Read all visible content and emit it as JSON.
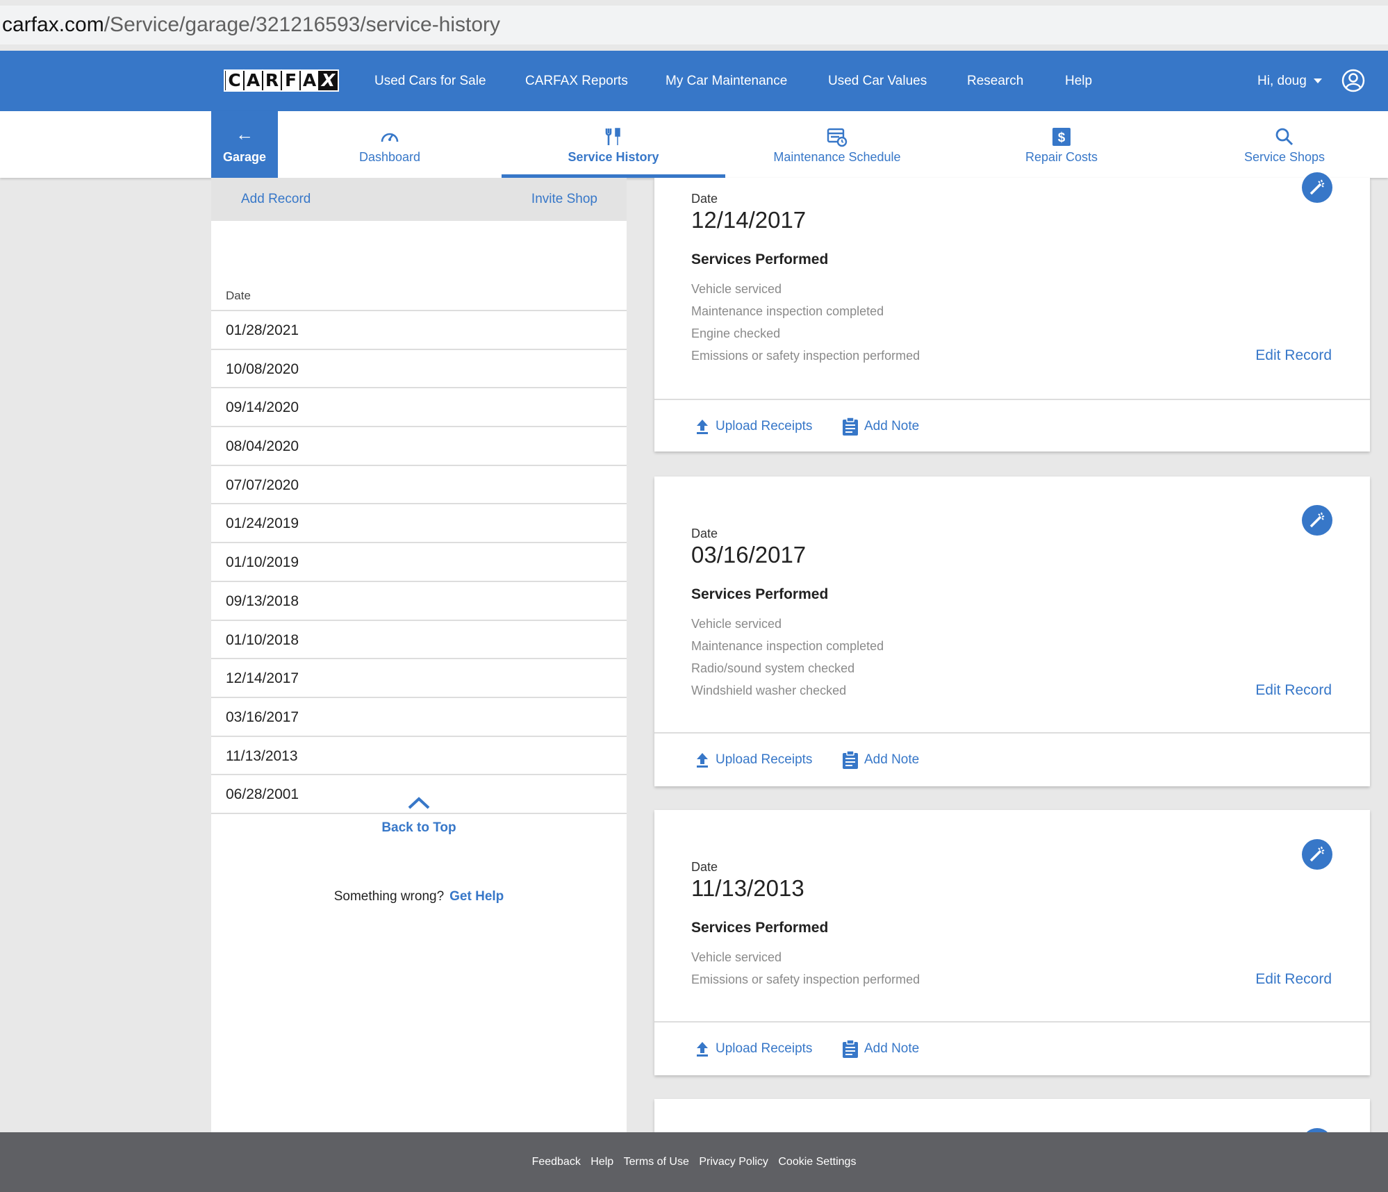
{
  "url": {
    "host": "carfax.com",
    "path": "/Service/garage/321216593/service-history"
  },
  "topnav": {
    "logo": [
      "C",
      "A",
      "R",
      "F",
      "A",
      "X"
    ],
    "links": [
      "Used Cars for Sale",
      "CARFAX Reports",
      "My Car Maintenance",
      "Used Car Values",
      "Research",
      "Help"
    ],
    "user_greeting": "Hi, doug"
  },
  "subnav": {
    "garage": "Garage",
    "tabs": [
      "Dashboard",
      "Service History",
      "Maintenance Schedule",
      "Repair Costs",
      "Service Shops"
    ],
    "active_tab": "Service History"
  },
  "sidebar": {
    "add_record": "Add Record",
    "invite_shop": "Invite Shop",
    "date_header": "Date",
    "dates": [
      "01/28/2021",
      "10/08/2020",
      "09/14/2020",
      "08/04/2020",
      "07/07/2020",
      "01/24/2019",
      "01/10/2019",
      "09/13/2018",
      "01/10/2018",
      "12/14/2017",
      "03/16/2017",
      "11/13/2013",
      "06/28/2001"
    ],
    "back_to_top": "Back to Top",
    "something_wrong": "Something wrong?",
    "get_help": "Get Help"
  },
  "cards": [
    {
      "date_label": "Date",
      "date": "12/14/2017",
      "services_title": "Services Performed",
      "services": [
        "Vehicle serviced",
        "Maintenance inspection completed",
        "Engine checked",
        "Emissions or safety inspection performed"
      ],
      "edit": "Edit Record",
      "upload": "Upload Receipts",
      "note": "Add Note"
    },
    {
      "date_label": "Date",
      "date": "03/16/2017",
      "services_title": "Services Performed",
      "services": [
        "Vehicle serviced",
        "Maintenance inspection completed",
        "Radio/sound system checked",
        "Windshield washer checked"
      ],
      "edit": "Edit Record",
      "upload": "Upload Receipts",
      "note": "Add Note"
    },
    {
      "date_label": "Date",
      "date": "11/13/2013",
      "services_title": "Services Performed",
      "services": [
        "Vehicle serviced",
        "Emissions or safety inspection performed"
      ],
      "edit": "Edit Record",
      "upload": "Upload Receipts",
      "note": "Add Note"
    }
  ],
  "footer": {
    "links": [
      "Feedback",
      "Help",
      "Terms of Use",
      "Privacy Policy",
      "Cookie Settings"
    ]
  },
  "colors": {
    "brand_blue": "#3777c8",
    "footer_gray": "#5f6064"
  }
}
